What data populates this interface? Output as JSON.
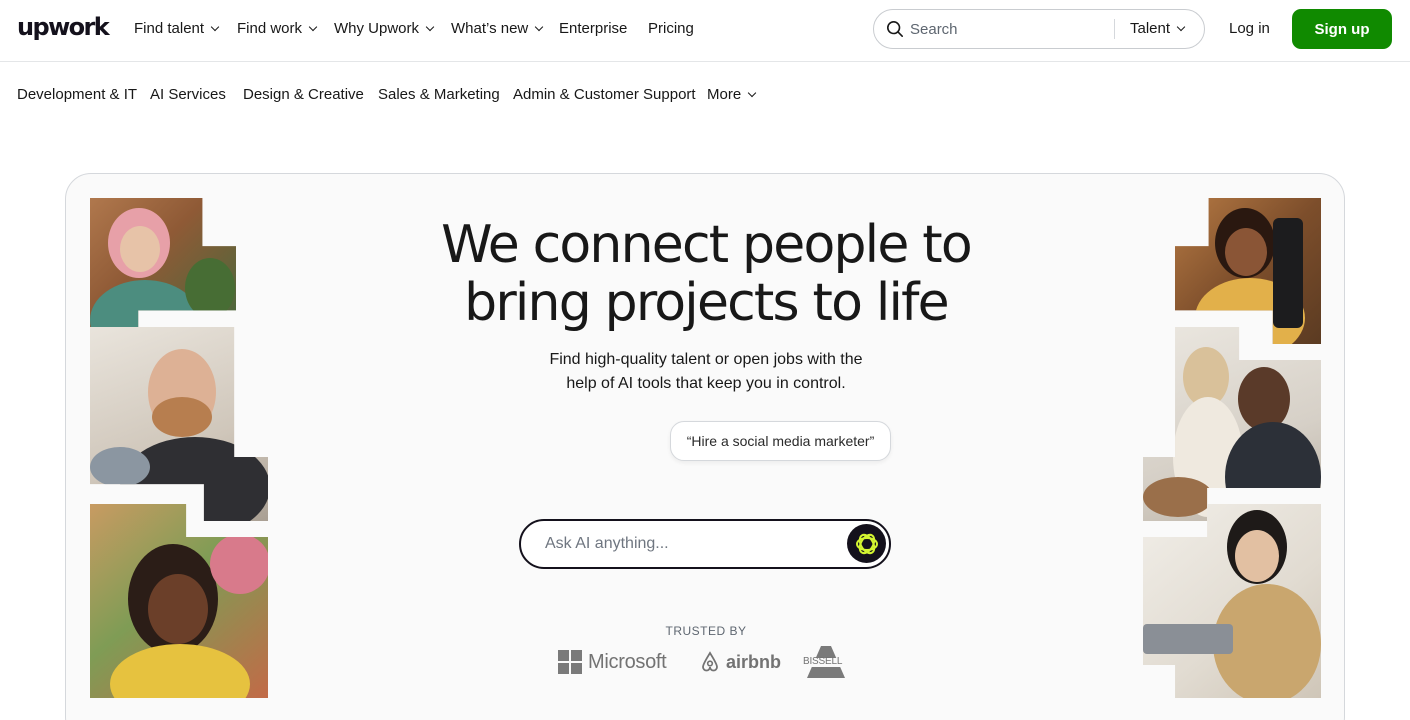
{
  "brand": {
    "logo_text": "upwork",
    "accent": "#108a00"
  },
  "nav": {
    "items": [
      {
        "label": "Find talent",
        "has_menu": true
      },
      {
        "label": "Find work",
        "has_menu": true
      },
      {
        "label": "Why Upwork",
        "has_menu": true
      },
      {
        "label": "What’s new",
        "has_menu": true
      },
      {
        "label": "Enterprise",
        "has_menu": false
      },
      {
        "label": "Pricing",
        "has_menu": false
      }
    ],
    "search": {
      "placeholder": "Search",
      "scope": "Talent"
    },
    "login": "Log in",
    "signup": "Sign up"
  },
  "categories": {
    "items": [
      "Development & IT",
      "AI Services",
      "Design & Creative",
      "Sales & Marketing",
      "Admin & Customer Support"
    ],
    "more": "More"
  },
  "hero": {
    "headline_line1": "We connect people to",
    "headline_line2": "bring projects to life",
    "subhead_line1": "Find high-quality talent or open jobs with the",
    "subhead_line2": "help of AI tools that keep you in control.",
    "suggestion": "“Hire a social media marketer”",
    "ask_placeholder": "Ask AI anything...",
    "ask_icon": "ai-sparkle-icon",
    "trusted_by": "TRUSTED BY",
    "logos": {
      "microsoft": "Microsoft",
      "airbnb": "airbnb",
      "bissell": "BISSELL"
    }
  }
}
